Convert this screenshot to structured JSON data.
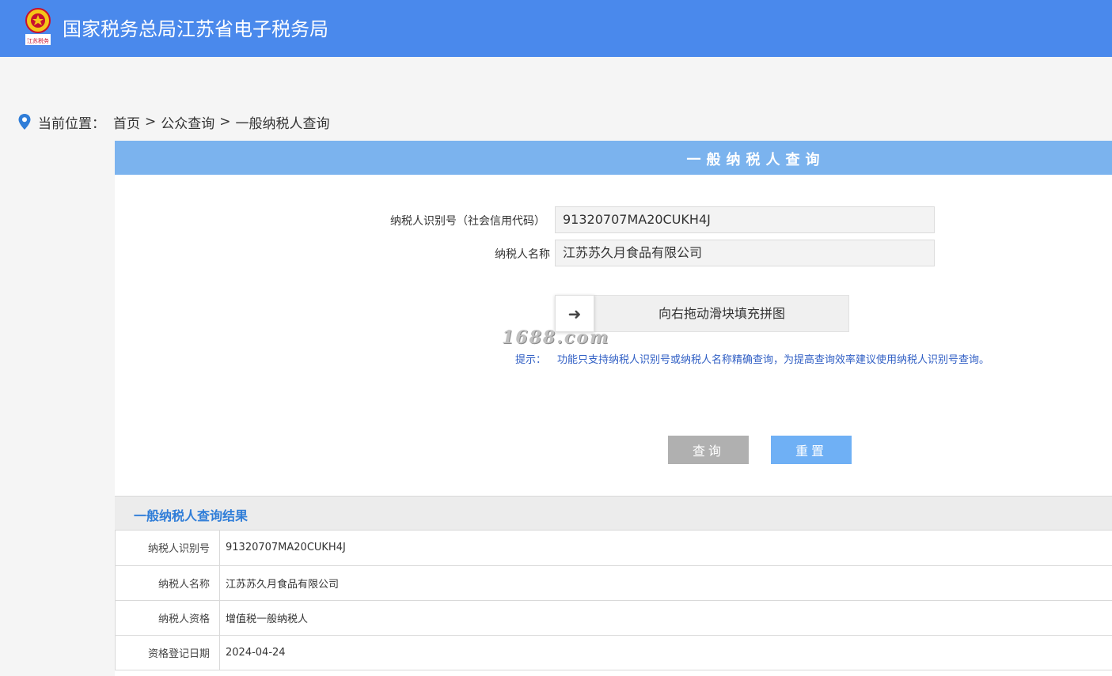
{
  "header": {
    "logo_text": "江苏税务",
    "site_title": "国家税务总局江苏省电子税务局",
    "colors": {
      "bar": "#4a89ec",
      "panel_head": "#7bb3ee"
    }
  },
  "breadcrumb": {
    "icon": "location-pin-icon",
    "label": "当前位置：",
    "items": [
      "首页",
      "公众查询",
      "一般纳税人查询"
    ],
    "separator": ">"
  },
  "form": {
    "title": "一般纳税人查询",
    "taxpayer_id_label": "纳税人识别号（社会信用代码）",
    "taxpayer_id_value": "91320707MA20CUKH4J",
    "taxpayer_name_label": "纳税人名称",
    "taxpayer_name_value": "江苏苏久月食品有限公司",
    "slider_icon": "arrow-right-icon",
    "slider_text": "向右拖动滑块填充拼图",
    "watermark": "1688.com",
    "tip_label": "提示：",
    "tip_text": "功能只支持纳税人识别号或纳税人名称精确查询，为提高查询效率建议使用纳税人识别号查询。",
    "query_button": "查询",
    "reset_button": "重置"
  },
  "results": {
    "title": "一般纳税人查询结果",
    "rows": [
      {
        "key": "纳税人识别号",
        "value": "91320707MA20CUKH4J"
      },
      {
        "key": "纳税人名称",
        "value": "江苏苏久月食品有限公司"
      },
      {
        "key": "纳税人资格",
        "value": "增值税一般纳税人"
      },
      {
        "key": "资格登记日期",
        "value": "2024-04-24"
      }
    ]
  }
}
